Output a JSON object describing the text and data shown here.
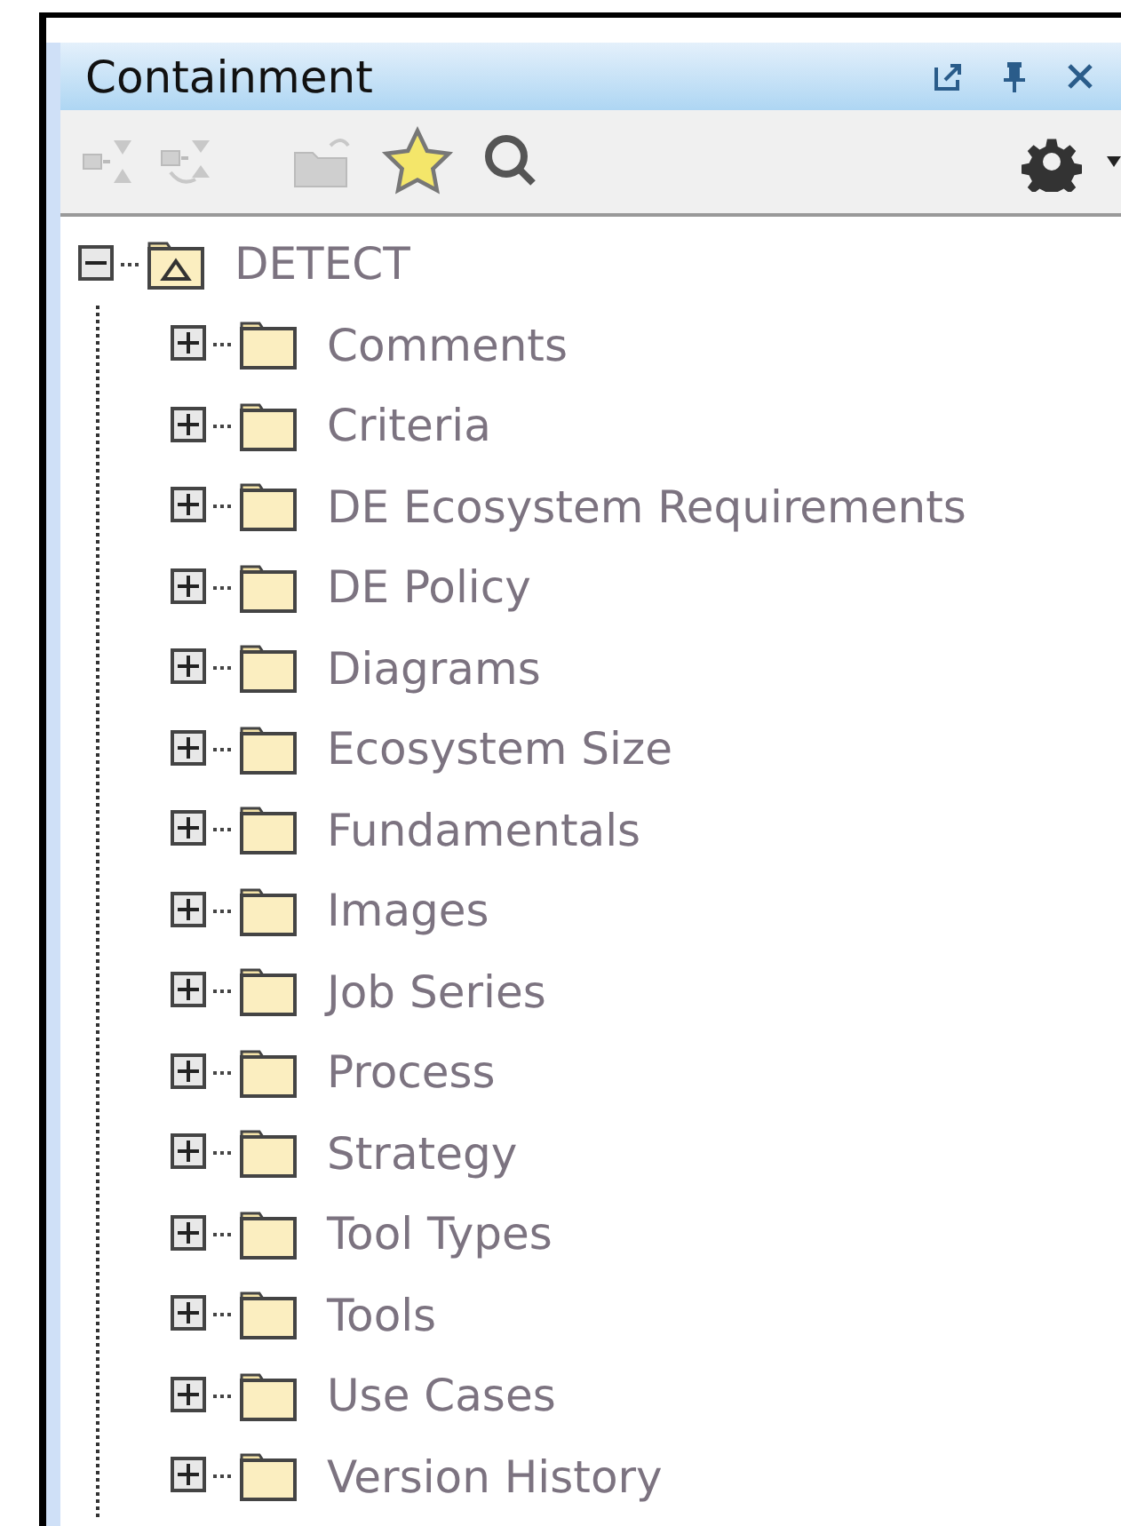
{
  "panel": {
    "title": "Containment"
  },
  "tree": [
    {
      "label": "DETECT",
      "kind": "model",
      "expanded": true,
      "children": [
        {
          "label": "Comments",
          "kind": "package",
          "expanded": false
        },
        {
          "label": "Criteria",
          "kind": "package",
          "expanded": false
        },
        {
          "label": "DE Ecosystem Requirements",
          "kind": "package",
          "expanded": false
        },
        {
          "label": "DE Policy",
          "kind": "package",
          "expanded": false
        },
        {
          "label": "Diagrams",
          "kind": "package",
          "expanded": false
        },
        {
          "label": "Ecosystem Size",
          "kind": "package",
          "expanded": false
        },
        {
          "label": "Fundamentals",
          "kind": "package",
          "expanded": false
        },
        {
          "label": "Images",
          "kind": "package",
          "expanded": false
        },
        {
          "label": "Job Series",
          "kind": "package",
          "expanded": false
        },
        {
          "label": "Process",
          "kind": "package",
          "expanded": false
        },
        {
          "label": "Strategy",
          "kind": "package",
          "expanded": false
        },
        {
          "label": "Tool Types",
          "kind": "package",
          "expanded": false
        },
        {
          "label": "Tools",
          "kind": "package",
          "expanded": false
        },
        {
          "label": "Use Cases",
          "kind": "package",
          "expanded": false
        },
        {
          "label": "Version History",
          "kind": "package",
          "expanded": false
        }
      ]
    }
  ]
}
